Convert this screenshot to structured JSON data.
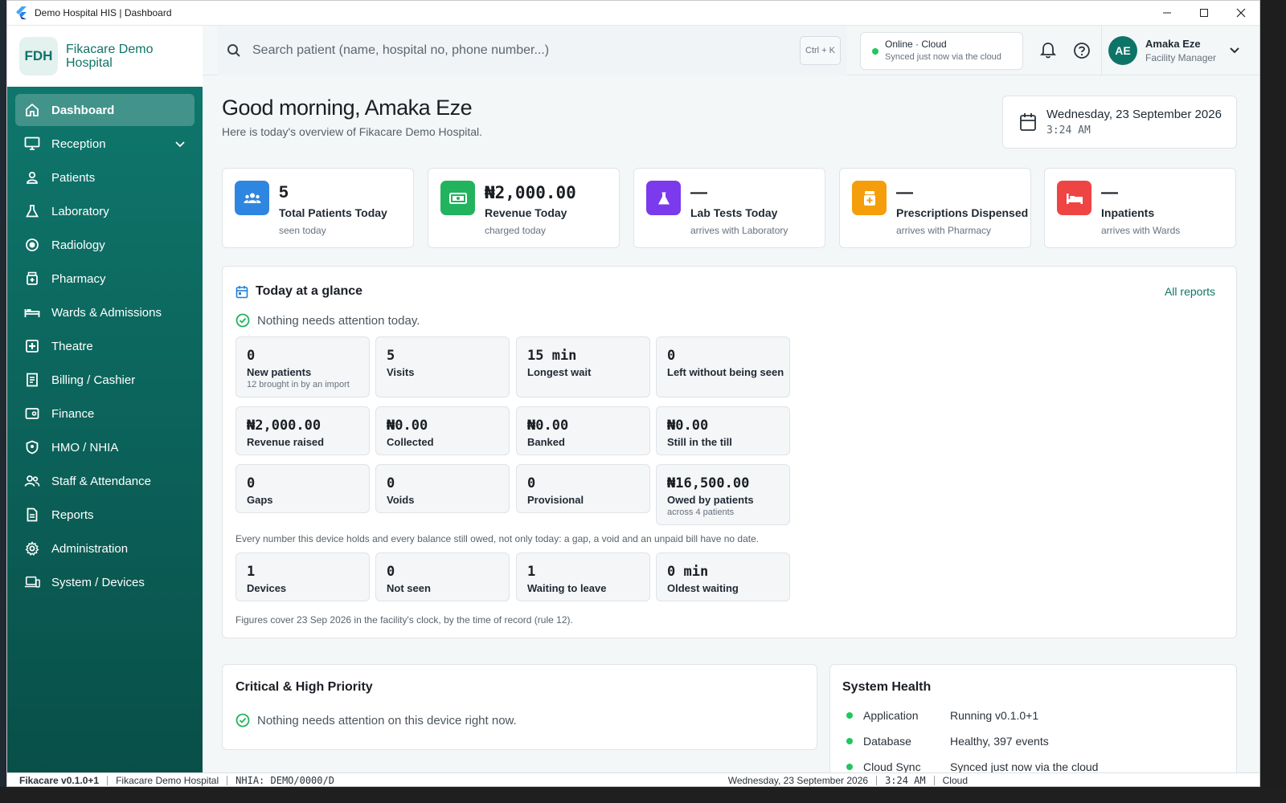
{
  "window": {
    "title": "Demo Hospital HIS | Dashboard"
  },
  "brand": {
    "logo_text": "FDH",
    "name": "Fikacare Demo Hospital",
    "accent": "#0f7468"
  },
  "nav": {
    "items": [
      {
        "label": "Dashboard",
        "icon": "home-icon",
        "active": true
      },
      {
        "label": "Reception",
        "icon": "monitor-icon",
        "has_submenu": true
      },
      {
        "label": "Patients",
        "icon": "person-icon"
      },
      {
        "label": "Laboratory",
        "icon": "flask-icon"
      },
      {
        "label": "Radiology",
        "icon": "radiology-icon"
      },
      {
        "label": "Pharmacy",
        "icon": "pharmacy-icon"
      },
      {
        "label": "Wards & Admissions",
        "icon": "bed-icon"
      },
      {
        "label": "Theatre",
        "icon": "theatre-icon"
      },
      {
        "label": "Billing / Cashier",
        "icon": "receipt-icon"
      },
      {
        "label": "Finance",
        "icon": "wallet-icon"
      },
      {
        "label": "HMO / NHIA",
        "icon": "shield-icon"
      },
      {
        "label": "Staff & Attendance",
        "icon": "people-icon"
      },
      {
        "label": "Reports",
        "icon": "document-icon"
      },
      {
        "label": "Administration",
        "icon": "gear-icon"
      },
      {
        "label": "System / Devices",
        "icon": "devices-icon"
      }
    ]
  },
  "topbar": {
    "search_placeholder": "Search patient (name, hospital no, phone number...)",
    "search_shortcut": "Ctrl + K",
    "status_title": "Online · Cloud",
    "status_detail": "Synced just now via the cloud",
    "user_initials": "AE",
    "user_name": "Amaka Eze",
    "user_role": "Facility Manager"
  },
  "header": {
    "greeting": "Good morning, Amaka Eze",
    "subtitle": "Here is today's overview of Fikacare Demo Hospital.",
    "date": "Wednesday, 23 September 2026",
    "time": "3:24 AM"
  },
  "stats": [
    {
      "value": "5",
      "label": "Total Patients Today",
      "sub": "seen today",
      "color": "#2f86e0",
      "icon": "patients-icon"
    },
    {
      "value": "₦2,000.00",
      "label": "Revenue Today",
      "sub": "charged today",
      "color": "#22b35e",
      "icon": "money-icon"
    },
    {
      "value": "—",
      "label": "Lab Tests Today",
      "sub": "arrives with Laboratory",
      "color": "#7c3aed",
      "icon": "flask-icon"
    },
    {
      "value": "—",
      "label": "Prescriptions Dispensed",
      "sub": "arrives with Pharmacy",
      "color": "#f59e0b",
      "icon": "pill-bottle-icon"
    },
    {
      "value": "—",
      "label": "Inpatients",
      "sub": "arrives with Wards",
      "color": "#ef4444",
      "icon": "bed-icon"
    }
  ],
  "glance": {
    "title": "Today at a glance",
    "all_reports": "All reports",
    "ok_message": "Nothing needs attention today.",
    "tiles": [
      {
        "value": "0",
        "label": "New patients",
        "sub": "12 brought in by an import"
      },
      {
        "value": "5",
        "label": "Visits"
      },
      {
        "value": "15 min",
        "label": "Longest wait"
      },
      {
        "value": "0",
        "label": "Left without being seen"
      },
      {
        "value": "₦2,000.00",
        "label": "Revenue raised"
      },
      {
        "value": "₦0.00",
        "label": "Collected"
      },
      {
        "value": "₦0.00",
        "label": "Banked"
      },
      {
        "value": "₦0.00",
        "label": "Still in the till"
      },
      {
        "value": "0",
        "label": "Gaps"
      },
      {
        "value": "0",
        "label": "Voids"
      },
      {
        "value": "0",
        "label": "Provisional"
      },
      {
        "value": "₦16,500.00",
        "label": "Owed by patients",
        "sub": "across 4 patients"
      },
      {
        "value": "1",
        "label": "Devices"
      },
      {
        "value": "0",
        "label": "Not seen"
      },
      {
        "value": "1",
        "label": "Waiting to leave"
      },
      {
        "value": "0 min",
        "label": "Oldest waiting"
      }
    ],
    "balance_note": "Every number this device holds and every balance still owed, not only today: a gap, a void and an unpaid bill have no date.",
    "footer_note": "Figures cover 23 Sep 2026 in the facility's clock, by the time of record (rule 12)."
  },
  "critical": {
    "title": "Critical & High Priority",
    "ok_message": "Nothing needs attention on this device right now."
  },
  "health": {
    "title": "System Health",
    "rows": [
      {
        "name": "Application",
        "value": "Running v0.1.0+1"
      },
      {
        "name": "Database",
        "value": "Healthy, 397 events"
      },
      {
        "name": "Cloud Sync",
        "value": "Synced just now via the cloud"
      }
    ]
  },
  "footer": {
    "version": "Fikacare v0.1.0+1",
    "facility": "Fikacare Demo Hospital",
    "nhia": "NHIA: DEMO/0000/D",
    "date": "Wednesday, 23 September 2026",
    "time": "3:24 AM",
    "mode": "Cloud"
  }
}
